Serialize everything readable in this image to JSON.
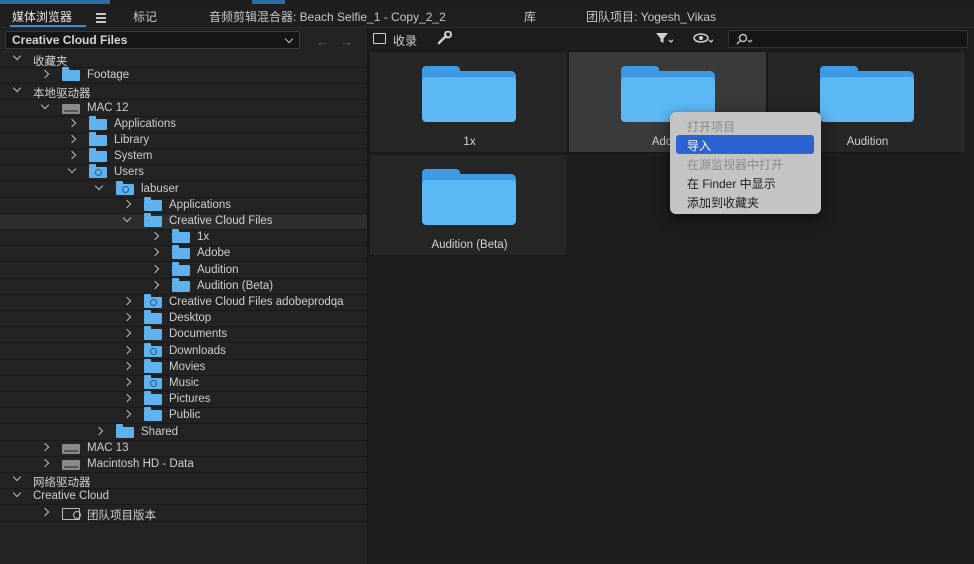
{
  "tabs": [
    {
      "label": "媒体浏览器",
      "active": true
    },
    {
      "label": "标记"
    },
    {
      "label": "音频剪辑混合器: Beach Selfie_1 - Copy_2_2"
    },
    {
      "label": "库"
    },
    {
      "label": "团队项目: Yogesh_Vikas"
    }
  ],
  "left_panel": {
    "location": "Creative Cloud Files",
    "tree": [
      {
        "label": "收藏夹",
        "level": 0,
        "expander": "open",
        "icon": "none"
      },
      {
        "label": "Footage",
        "level": 1,
        "expander": "closed",
        "icon": "folder"
      },
      {
        "label": "本地驱动器",
        "level": 0,
        "expander": "open",
        "icon": "none"
      },
      {
        "label": "MAC 12",
        "level": 1,
        "expander": "open",
        "icon": "drive"
      },
      {
        "label": "Applications",
        "level": 2,
        "expander": "closed",
        "icon": "folder"
      },
      {
        "label": "Library",
        "level": 2,
        "expander": "closed",
        "icon": "folder"
      },
      {
        "label": "System",
        "level": 2,
        "expander": "closed",
        "icon": "folder"
      },
      {
        "label": "Users",
        "level": 2,
        "expander": "open",
        "icon": "folder-gear"
      },
      {
        "label": "labuser",
        "level": 3,
        "expander": "open",
        "icon": "folder-gear"
      },
      {
        "label": "Applications",
        "level": 4,
        "expander": "closed",
        "icon": "folder"
      },
      {
        "label": "Creative Cloud Files",
        "level": 4,
        "expander": "open",
        "icon": "folder",
        "selected": true
      },
      {
        "label": "1x",
        "level": 5,
        "expander": "closed",
        "icon": "folder"
      },
      {
        "label": "Adobe",
        "level": 5,
        "expander": "closed",
        "icon": "folder"
      },
      {
        "label": "Audition",
        "level": 5,
        "expander": "closed",
        "icon": "folder"
      },
      {
        "label": "Audition (Beta)",
        "level": 5,
        "expander": "closed",
        "icon": "folder"
      },
      {
        "label": "Creative Cloud Files adobeprodqa",
        "level": 4,
        "expander": "closed",
        "icon": "folder-gear"
      },
      {
        "label": "Desktop",
        "level": 4,
        "expander": "closed",
        "icon": "folder"
      },
      {
        "label": "Documents",
        "level": 4,
        "expander": "closed",
        "icon": "folder"
      },
      {
        "label": "Downloads",
        "level": 4,
        "expander": "closed",
        "icon": "folder-gear"
      },
      {
        "label": "Movies",
        "level": 4,
        "expander": "closed",
        "icon": "folder"
      },
      {
        "label": "Music",
        "level": 4,
        "expander": "closed",
        "icon": "folder-gear"
      },
      {
        "label": "Pictures",
        "level": 4,
        "expander": "closed",
        "icon": "folder"
      },
      {
        "label": "Public",
        "level": 4,
        "expander": "closed",
        "icon": "folder"
      },
      {
        "label": "Shared",
        "level": 3,
        "expander": "closed",
        "icon": "folder"
      },
      {
        "label": "MAC 13",
        "level": 1,
        "expander": "closed",
        "icon": "drive"
      },
      {
        "label": "Macintosh HD - Data",
        "level": 1,
        "expander": "closed",
        "icon": "drive"
      },
      {
        "label": "网络驱动器",
        "level": 0,
        "expander": "open",
        "icon": "none"
      },
      {
        "label": "Creative Cloud",
        "level": 0,
        "expander": "open",
        "icon": "none"
      },
      {
        "label": "团队项目版本",
        "level": 1,
        "expander": "closed",
        "icon": "team"
      }
    ]
  },
  "toolbar": {
    "ingest_label": "收录",
    "search_value": ""
  },
  "grid_items": [
    {
      "name": "1x"
    },
    {
      "name": "Adobe",
      "hovered": true
    },
    {
      "name": "Audition"
    },
    {
      "name": "Audition (Beta)"
    }
  ],
  "context_menu": {
    "items": [
      {
        "label": "打开项目",
        "state": "disabled"
      },
      {
        "label": "导入",
        "state": "highlighted"
      },
      {
        "label": "在源监视器中打开",
        "state": "disabled"
      },
      {
        "label": "在 Finder 中显示",
        "state": "normal"
      },
      {
        "label": "添加到收藏夹",
        "state": "normal"
      }
    ]
  },
  "colors": {
    "accent": "#3d8fe0",
    "folder": "#5cb8f4",
    "menu_highlight": "#2b63d1"
  }
}
